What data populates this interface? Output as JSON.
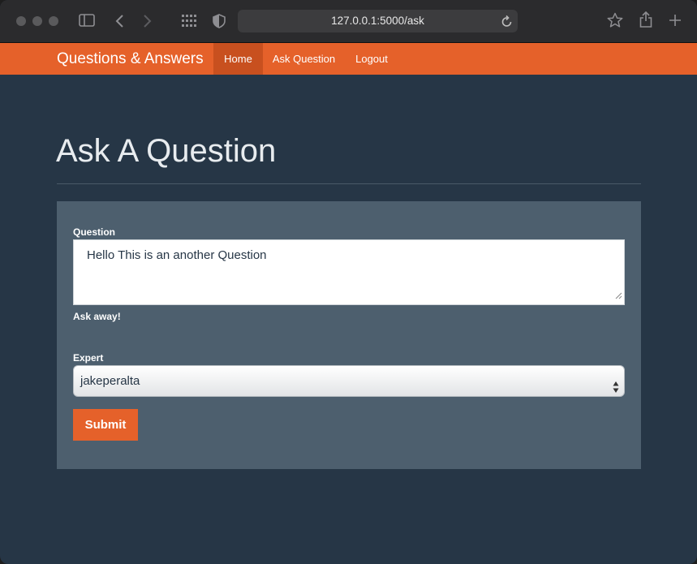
{
  "browser": {
    "url": "127.0.0.1:5000/ask"
  },
  "navbar": {
    "brand": "Questions & Answers",
    "items": [
      {
        "label": "Home",
        "active": true
      },
      {
        "label": "Ask Question",
        "active": false
      },
      {
        "label": "Logout",
        "active": false
      }
    ]
  },
  "page": {
    "title": "Ask A Question"
  },
  "form": {
    "question_label": "Question",
    "question_value": "Hello This is an another Question",
    "question_help": "Ask away!",
    "expert_label": "Expert",
    "expert_selected": "jakeperalta",
    "submit_label": "Submit"
  },
  "colors": {
    "accent": "#e5612a",
    "background": "#263646",
    "panel": "#4d5f6e"
  }
}
